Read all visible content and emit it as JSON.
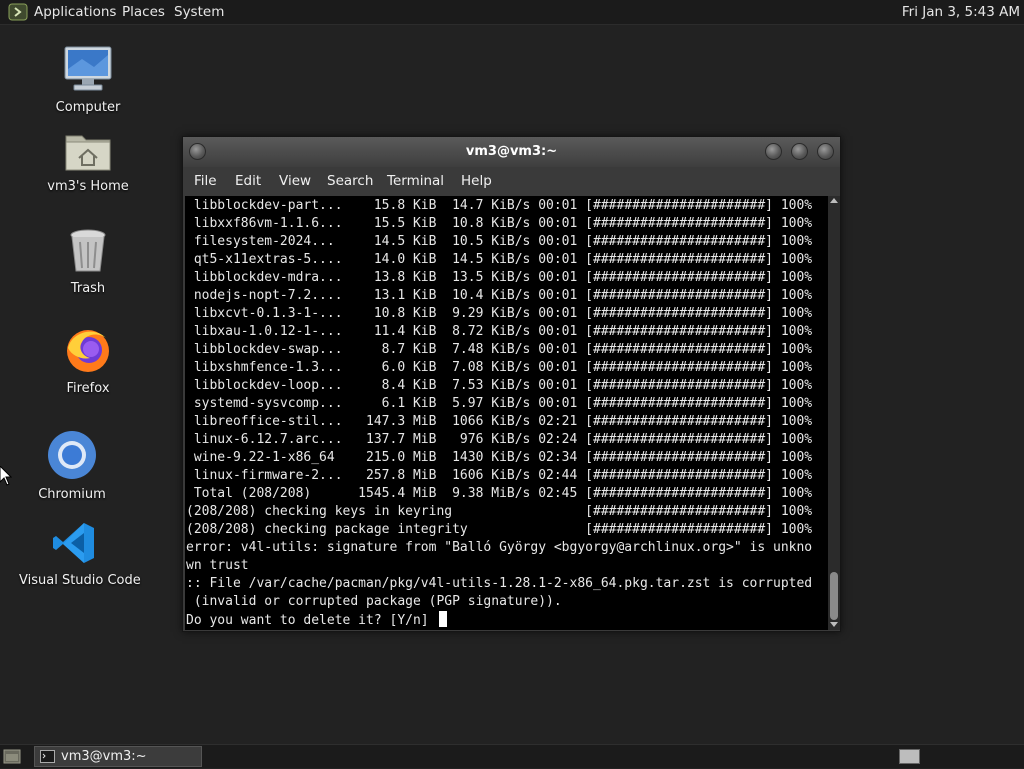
{
  "top_panel": {
    "menus": [
      "Applications",
      "Places",
      "System"
    ],
    "clock": "Fri Jan  3,  5:43 AM"
  },
  "desktop": {
    "icons": [
      {
        "label": "Computer",
        "icon": "computer-icon"
      },
      {
        "label": "vm3's Home",
        "icon": "home-folder-icon"
      },
      {
        "label": "Trash",
        "icon": "trash-icon"
      },
      {
        "label": "Firefox",
        "icon": "firefox-icon"
      },
      {
        "label": "Chromium",
        "icon": "chromium-icon"
      },
      {
        "label": "Visual Studio Code",
        "icon": "vscode-icon"
      }
    ]
  },
  "terminal": {
    "title": "vm3@vm3:~",
    "menu": [
      "File",
      "Edit",
      "View",
      "Search",
      "Terminal",
      "Help"
    ],
    "lines": [
      " libblockdev-part...    15.8 KiB  14.7 KiB/s 00:01 [######################] 100%",
      " libxxf86vm-1.1.6...    15.5 KiB  10.8 KiB/s 00:01 [######################] 100%",
      " filesystem-2024...     14.5 KiB  10.5 KiB/s 00:01 [######################] 100%",
      " qt5-x11extras-5....    14.0 KiB  14.5 KiB/s 00:01 [######################] 100%",
      " libblockdev-mdra...    13.8 KiB  13.5 KiB/s 00:01 [######################] 100%",
      " nodejs-nopt-7.2....    13.1 KiB  10.4 KiB/s 00:01 [######################] 100%",
      " libxcvt-0.1.3-1-...    10.8 KiB  9.29 KiB/s 00:01 [######################] 100%",
      " libxau-1.0.12-1-...    11.4 KiB  8.72 KiB/s 00:01 [######################] 100%",
      " libblockdev-swap...     8.7 KiB  7.48 KiB/s 00:01 [######################] 100%",
      " libxshmfence-1.3...     6.0 KiB  7.08 KiB/s 00:01 [######################] 100%",
      " libblockdev-loop...     8.4 KiB  7.53 KiB/s 00:01 [######################] 100%",
      " systemd-sysvcomp...     6.1 KiB  5.97 KiB/s 00:01 [######################] 100%",
      " libreoffice-stil...   147.3 MiB  1066 KiB/s 02:21 [######################] 100%",
      " linux-6.12.7.arc...   137.7 MiB   976 KiB/s 02:24 [######################] 100%",
      " wine-9.22-1-x86_64    215.0 MiB  1430 KiB/s 02:34 [######################] 100%",
      " linux-firmware-2...   257.8 MiB  1606 KiB/s 02:44 [######################] 100%",
      " Total (208/208)      1545.4 MiB  9.38 MiB/s 02:45 [######################] 100%",
      "(208/208) checking keys in keyring                 [######################] 100%",
      "(208/208) checking package integrity               [######################] 100%",
      "error: v4l-utils: signature from \"Balló György <bgyorgy@archlinux.org>\" is unkno",
      "wn trust",
      ":: File /var/cache/pacman/pkg/v4l-utils-1.28.1-2-x86_64.pkg.tar.zst is corrupted",
      " (invalid or corrupted package (PGP signature)).",
      "Do you want to delete it? [Y/n] "
    ]
  },
  "taskbar": {
    "task_label": "vm3@vm3:~"
  },
  "colors": {
    "desktop_bg": "#222222",
    "panel_bg": "#1b1b1b",
    "terminal_bg": "#000000",
    "terminal_fg": "#e8e8e8"
  }
}
